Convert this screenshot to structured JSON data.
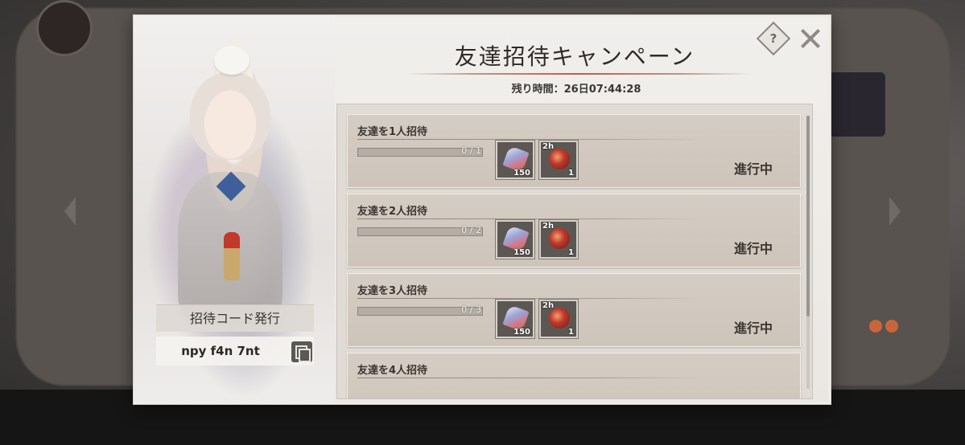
{
  "dialog": {
    "title": "友達招待キャンペーン",
    "timer": "残り時間：26日07:44:28",
    "help_label": "?"
  },
  "invite": {
    "label": "招待コード発行",
    "code": "npy f4n 7nt"
  },
  "missions": [
    {
      "title": "友達を1人招待",
      "progress_text": "0 / 1",
      "progress": 0,
      "rewards": [
        {
          "icon": "crystal-icon",
          "qty": "150",
          "tag": ""
        },
        {
          "icon": "orb-icon",
          "qty": "1",
          "tag": "2h"
        }
      ],
      "status": "進行中"
    },
    {
      "title": "友達を2人招待",
      "progress_text": "0 / 2",
      "progress": 0,
      "rewards": [
        {
          "icon": "crystal-icon",
          "qty": "150",
          "tag": ""
        },
        {
          "icon": "orb-icon",
          "qty": "1",
          "tag": "2h"
        }
      ],
      "status": "進行中"
    },
    {
      "title": "友達を3人招待",
      "progress_text": "0 / 3",
      "progress": 0,
      "rewards": [
        {
          "icon": "crystal-icon",
          "qty": "150",
          "tag": ""
        },
        {
          "icon": "orb-icon",
          "qty": "1",
          "tag": "2h"
        }
      ],
      "status": "進行中"
    },
    {
      "title": "友達を4人招待"
    }
  ]
}
